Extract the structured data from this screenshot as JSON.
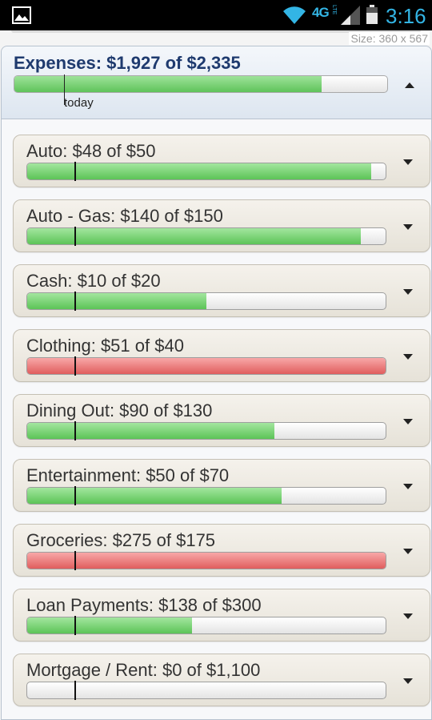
{
  "status_bar": {
    "network": "4G",
    "network_sub": "LTE",
    "time": "3:16",
    "accent_color": "#33b5e5",
    "icons": [
      "gallery-icon",
      "wifi-icon",
      "signal-icon",
      "battery-icon"
    ]
  },
  "overlay": {
    "size_label": "Size: 360 x 567"
  },
  "summary": {
    "title": "Expenses: $1,927 of $2,335",
    "spent": 1927,
    "budget": 2335,
    "progress": 0.825,
    "today_label": "today",
    "today_fraction": 0.135
  },
  "categories": [
    {
      "label": "Auto: $48 of $50",
      "progress": 0.96,
      "status": "ok"
    },
    {
      "label": "Auto - Gas: $140 of $150",
      "progress": 0.93,
      "status": "ok"
    },
    {
      "label": "Cash: $10 of $20",
      "progress": 0.5,
      "status": "ok"
    },
    {
      "label": "Clothing: $51 of $40",
      "progress": 1.0,
      "status": "over"
    },
    {
      "label": "Dining Out: $90 of $130",
      "progress": 0.69,
      "status": "ok"
    },
    {
      "label": "Entertainment: $50 of $70",
      "progress": 0.71,
      "status": "ok"
    },
    {
      "label": "Groceries: $275 of $175",
      "progress": 1.0,
      "status": "over"
    },
    {
      "label": "Loan Payments: $138 of $300",
      "progress": 0.46,
      "status": "ok"
    },
    {
      "label": "Mortgage / Rent: $0 of $1,100",
      "progress": 0.0,
      "status": "ok"
    }
  ],
  "colors": {
    "ok": "#5cc457",
    "over": "#e05d5d",
    "header_title": "#1e3a6e"
  }
}
